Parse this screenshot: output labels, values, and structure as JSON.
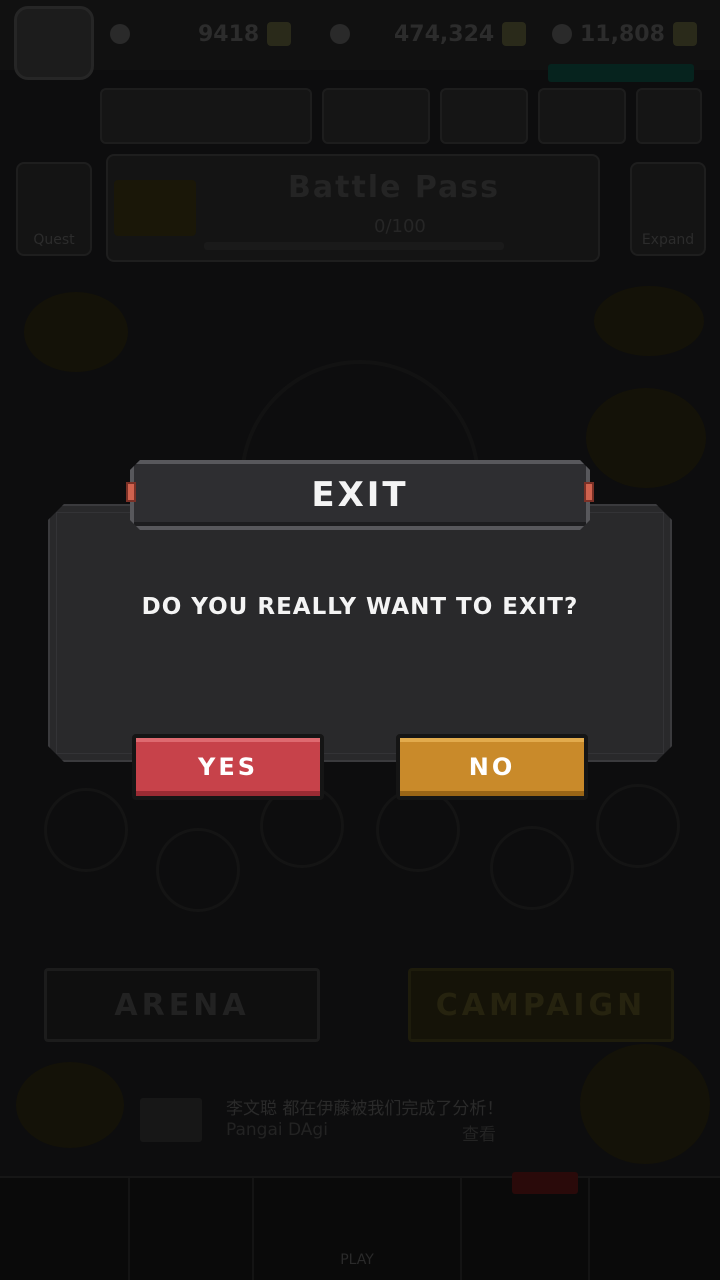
{
  "background": {
    "resources": {
      "gems": "9418",
      "gold": "474,324",
      "energy": "11,808"
    },
    "battle_pass": {
      "title": "Battle Pass",
      "progress": "0/100"
    },
    "side_buttons": {
      "left": "Quest",
      "right": "Expand"
    },
    "modes": {
      "arena": "ARENA",
      "campaign": "CAMPAIGN"
    },
    "news": {
      "headline": "李文聪 都在伊藤被我们完成了分析！",
      "author": "Pangai DAgi",
      "action": "查看"
    },
    "bottom_nav": {
      "center": "PLAY"
    }
  },
  "dialog": {
    "title": "EXIT",
    "message": "DO YOU REALLY WANT TO EXIT?",
    "yes_label": "YES",
    "no_label": "NO"
  },
  "colors": {
    "yes": "#c7424a",
    "no": "#c98a2a",
    "panel": "#29292b"
  }
}
